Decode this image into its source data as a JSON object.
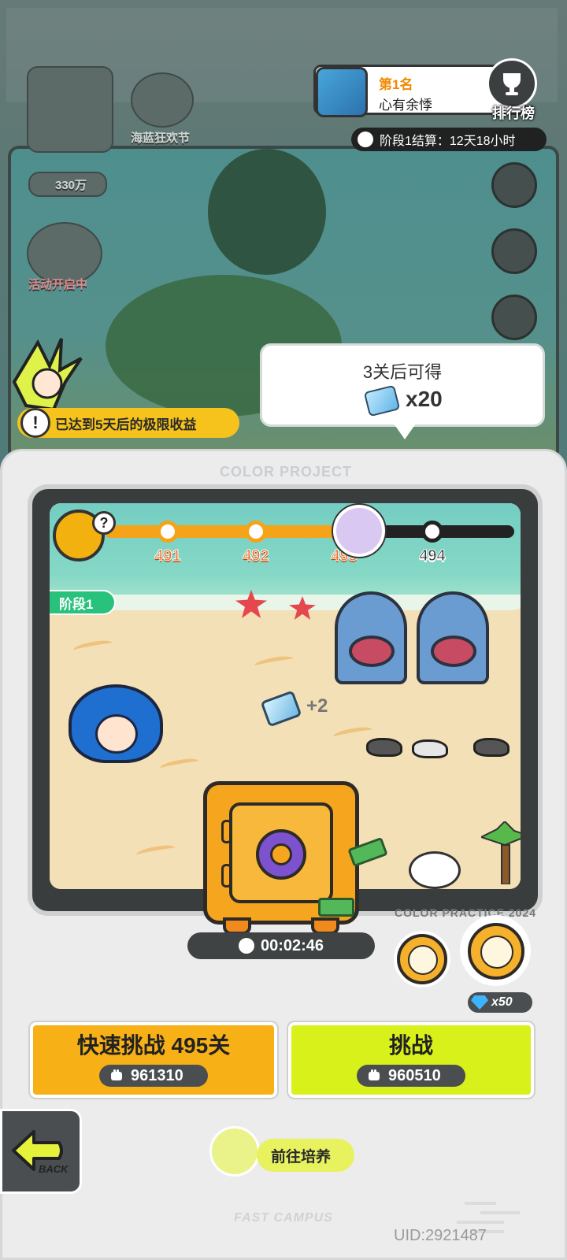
{
  "background": {
    "banner_event": "海蓝狂欢节",
    "power_value": "330万",
    "event_status": "活动开启中"
  },
  "ranking": {
    "rank": "第1名",
    "player_name": "心有余悸",
    "button_label": "排行榜"
  },
  "stage_settlement": "阶段1结算：12天18小时",
  "reward_bubble": {
    "title": "3关后可得",
    "count": "x20"
  },
  "limit_notice": "已达到5天后的极限收益",
  "panel": {
    "title": "COLOR PROJECT",
    "stage_tag": "阶段1",
    "level_nodes": [
      "491",
      "492",
      "493",
      "494"
    ],
    "current_level_index": 2,
    "pickup_count": "+2",
    "watermark": "COLOR PRACTICE 2024"
  },
  "safe": {
    "timer": "00:02:46"
  },
  "boost": {
    "gem_cost": "x50"
  },
  "buttons": {
    "quick_challenge": {
      "label": "快速挑战 495关",
      "power": "961310"
    },
    "challenge": {
      "label": "挑战",
      "power": "960510"
    },
    "back": "BACK",
    "train": "前往培养"
  },
  "footer": {
    "mark": "FAST CAMPUS",
    "uid": "UID:2921487"
  },
  "colors": {
    "accent_orange": "#f7b016",
    "accent_lime": "#d9f11a",
    "progress": "#f5a318",
    "stage_green": "#29c27c"
  }
}
